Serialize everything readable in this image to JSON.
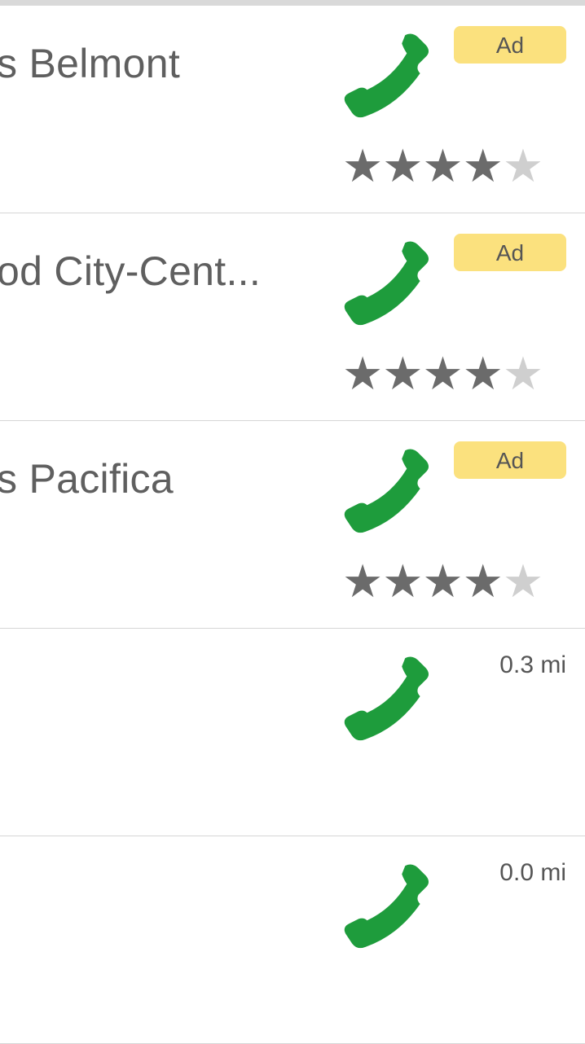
{
  "colors": {
    "phone_green": "#1e9c3c",
    "ad_yellow": "#fbe17e",
    "star_filled": "#6b6b6b",
    "star_empty": "#cfcfcf"
  },
  "listings": [
    {
      "title": "s Belmont",
      "badge": "Ad",
      "rating": 4,
      "max_rating": 5,
      "phone_icon": "phone-icon"
    },
    {
      "title": "od City-Cent...",
      "badge": "Ad",
      "rating": 4,
      "max_rating": 5,
      "phone_icon": "phone-icon"
    },
    {
      "title": "s Pacifica",
      "badge": "Ad",
      "rating": 4,
      "max_rating": 5,
      "phone_icon": "phone-icon"
    },
    {
      "title": "",
      "distance": "0.3 mi",
      "phone_icon": "phone-icon"
    },
    {
      "title": "",
      "distance": "0.0 mi",
      "phone_icon": "phone-icon"
    }
  ],
  "star_glyph": "★"
}
